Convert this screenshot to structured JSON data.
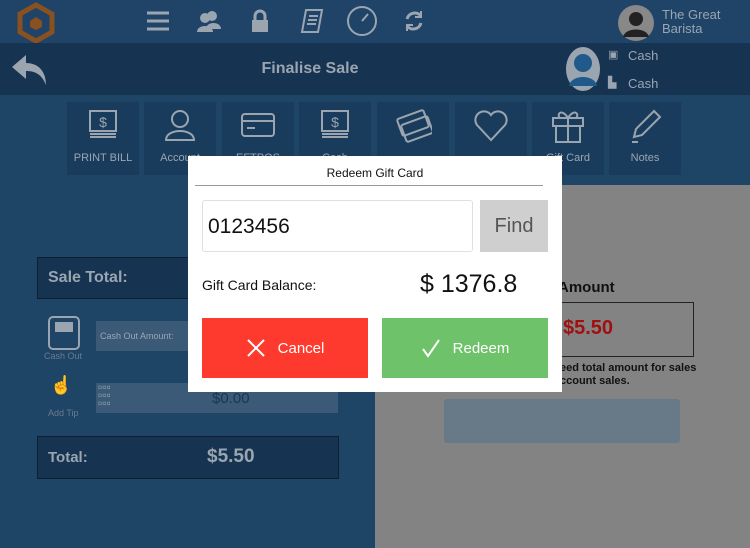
{
  "header": {
    "user_name": "The Great Barista",
    "title": "Finalise Sale",
    "customer_line1": "Cash",
    "customer_line2": "Cash"
  },
  "nav_icons": [
    "menu-icon",
    "users-icon",
    "lock-icon",
    "receipt-icon",
    "dashboard-icon",
    "sync-icon"
  ],
  "tools": [
    {
      "label": "PRINT BILL",
      "icon": "money-icon"
    },
    {
      "label": "Account",
      "icon": "person-icon"
    },
    {
      "label": "EFTPOS",
      "icon": "card-icon"
    },
    {
      "label": "Cash",
      "icon": "money-icon"
    },
    {
      "label": "",
      "icon": "cards-icon"
    },
    {
      "label": "",
      "icon": "heart-icon"
    },
    {
      "label": "Gift Card",
      "icon": "gift-icon"
    },
    {
      "label": "Notes",
      "icon": "pen-icon"
    }
  ],
  "left": {
    "sale_total_label": "Sale Total:",
    "cash_out_label": "Cash Out",
    "cash_out_placeholder": "Cash Out Amount:",
    "add_tip_label": "Add Tip",
    "tip_value": "$0.00",
    "total_label": "Total:",
    "total_value": "$5.50"
  },
  "right": {
    "amount_label": "Amount",
    "amount_value": "$5.50",
    "note_line1": "eed total amount for sales",
    "note_line2": "ccount sales."
  },
  "dialog": {
    "title": "Redeem Gift Card",
    "card_number": "0123456",
    "find_label": "Find",
    "balance_label": "Gift Card Balance:",
    "balance_value": "$ 1376.8",
    "cancel_label": "Cancel",
    "redeem_label": "Redeem"
  },
  "colors": {
    "cancel": "#fd3a2d",
    "redeem": "#6dc26a",
    "brand": "#b5651d",
    "amount": "#a01010"
  }
}
